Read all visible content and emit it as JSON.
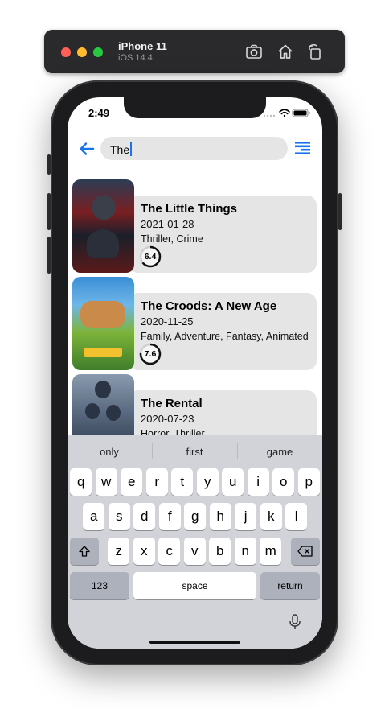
{
  "simulator": {
    "device_name": "iPhone 11",
    "os_version": "iOS 14.4",
    "icons": [
      "screenshot-icon",
      "home-icon",
      "rotate-icon"
    ]
  },
  "status_bar": {
    "time": "2:49"
  },
  "search": {
    "value": "The"
  },
  "movies": [
    {
      "title": "The Little Things",
      "date": "2021-01-28",
      "genres": "Thriller, Crime",
      "rating": "6.4",
      "rating_fraction": 0.64,
      "poster_colors": [
        "#7a1f22",
        "#1d3344"
      ]
    },
    {
      "title": "The Croods: A New Age",
      "date": "2020-11-25",
      "genres": "Family, Adventure, Fantasy, Animated",
      "rating": "7.6",
      "rating_fraction": 0.76,
      "poster_colors": [
        "#3a8ed6",
        "#3f7d2a"
      ]
    },
    {
      "title": "The Rental",
      "date": "2020-07-23",
      "genres": "Horror, Thriller",
      "rating": "",
      "rating_fraction": 0,
      "poster_colors": [
        "#7c8fa6",
        "#1e2a3a"
      ]
    }
  ],
  "keyboard": {
    "suggestions": [
      "only",
      "first",
      "game"
    ],
    "row1": [
      "q",
      "w",
      "e",
      "r",
      "t",
      "y",
      "u",
      "i",
      "o",
      "p"
    ],
    "row2": [
      "a",
      "s",
      "d",
      "f",
      "g",
      "h",
      "j",
      "k",
      "l"
    ],
    "row3": [
      "z",
      "x",
      "c",
      "v",
      "b",
      "n",
      "m"
    ],
    "num_key": "123",
    "space_key": "space",
    "return_key": "return"
  },
  "colors": {
    "accent": "#1a73e8",
    "card": "#e5e5e5"
  }
}
